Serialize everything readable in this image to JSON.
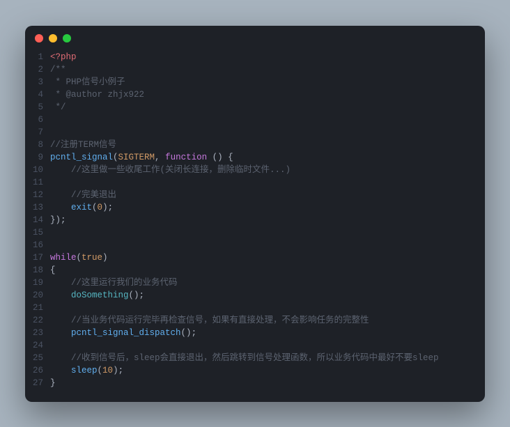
{
  "window": {
    "dots": [
      "red",
      "yellow",
      "green"
    ]
  },
  "code": {
    "lines": [
      {
        "n": "1",
        "seg": [
          {
            "c": "k-php",
            "t": "<?php"
          }
        ]
      },
      {
        "n": "2",
        "seg": [
          {
            "c": "k-comment",
            "t": "/**"
          }
        ]
      },
      {
        "n": "3",
        "seg": [
          {
            "c": "k-comment",
            "t": " * PHP信号小例子"
          }
        ]
      },
      {
        "n": "4",
        "seg": [
          {
            "c": "k-comment",
            "t": " * @author zhjx922"
          }
        ]
      },
      {
        "n": "5",
        "seg": [
          {
            "c": "k-comment",
            "t": " */"
          }
        ]
      },
      {
        "n": "6",
        "seg": []
      },
      {
        "n": "7",
        "seg": []
      },
      {
        "n": "8",
        "seg": [
          {
            "c": "k-comment",
            "t": "//注册TERM信号"
          }
        ]
      },
      {
        "n": "9",
        "seg": [
          {
            "c": "k-func",
            "t": "pcntl_signal"
          },
          {
            "c": "k-paren",
            "t": "("
          },
          {
            "c": "k-const",
            "t": "SIGTERM"
          },
          {
            "c": "k-punct",
            "t": ", "
          },
          {
            "c": "k-keyword",
            "t": "function"
          },
          {
            "c": "k-punct",
            "t": " "
          },
          {
            "c": "k-paren",
            "t": "()"
          },
          {
            "c": "k-punct",
            "t": " {"
          }
        ]
      },
      {
        "n": "10",
        "seg": [
          {
            "c": "k-punct",
            "t": "    "
          },
          {
            "c": "k-comment",
            "t": "//这里做一些收尾工作(关闭长连接，删除临时文件...)"
          }
        ]
      },
      {
        "n": "11",
        "seg": []
      },
      {
        "n": "12",
        "seg": [
          {
            "c": "k-punct",
            "t": "    "
          },
          {
            "c": "k-comment",
            "t": "//完美退出"
          }
        ]
      },
      {
        "n": "13",
        "seg": [
          {
            "c": "k-punct",
            "t": "    "
          },
          {
            "c": "k-func",
            "t": "exit"
          },
          {
            "c": "k-paren",
            "t": "("
          },
          {
            "c": "k-num",
            "t": "0"
          },
          {
            "c": "k-paren",
            "t": ")"
          },
          {
            "c": "k-punct",
            "t": ";"
          }
        ]
      },
      {
        "n": "14",
        "seg": [
          {
            "c": "k-punct",
            "t": "});"
          }
        ]
      },
      {
        "n": "15",
        "seg": []
      },
      {
        "n": "16",
        "seg": []
      },
      {
        "n": "17",
        "seg": [
          {
            "c": "k-keyword",
            "t": "while"
          },
          {
            "c": "k-paren",
            "t": "("
          },
          {
            "c": "k-bool",
            "t": "true"
          },
          {
            "c": "k-paren",
            "t": ")"
          }
        ]
      },
      {
        "n": "18",
        "seg": [
          {
            "c": "k-punct",
            "t": "{"
          }
        ]
      },
      {
        "n": "19",
        "seg": [
          {
            "c": "k-punct",
            "t": "    "
          },
          {
            "c": "k-comment",
            "t": "//这里运行我们的业务代码"
          }
        ]
      },
      {
        "n": "20",
        "seg": [
          {
            "c": "k-punct",
            "t": "    "
          },
          {
            "c": "k-call",
            "t": "doSomething"
          },
          {
            "c": "k-paren",
            "t": "()"
          },
          {
            "c": "k-punct",
            "t": ";"
          }
        ]
      },
      {
        "n": "21",
        "seg": []
      },
      {
        "n": "22",
        "seg": [
          {
            "c": "k-punct",
            "t": "    "
          },
          {
            "c": "k-comment",
            "t": "//当业务代码运行完毕再检查信号，如果有直接处理，不会影响任务的完整性"
          }
        ]
      },
      {
        "n": "23",
        "seg": [
          {
            "c": "k-punct",
            "t": "    "
          },
          {
            "c": "k-func",
            "t": "pcntl_signal_dispatch"
          },
          {
            "c": "k-paren",
            "t": "()"
          },
          {
            "c": "k-punct",
            "t": ";"
          }
        ]
      },
      {
        "n": "24",
        "seg": []
      },
      {
        "n": "25",
        "seg": [
          {
            "c": "k-punct",
            "t": "    "
          },
          {
            "c": "k-comment",
            "t": "//收到信号后，sleep会直接退出，然后跳转到信号处理函数，所以业务代码中最好不要sleep"
          }
        ]
      },
      {
        "n": "26",
        "seg": [
          {
            "c": "k-punct",
            "t": "    "
          },
          {
            "c": "k-func",
            "t": "sleep"
          },
          {
            "c": "k-paren",
            "t": "("
          },
          {
            "c": "k-num",
            "t": "10"
          },
          {
            "c": "k-paren",
            "t": ")"
          },
          {
            "c": "k-punct",
            "t": ";"
          }
        ]
      },
      {
        "n": "27",
        "seg": [
          {
            "c": "k-punct",
            "t": "}"
          }
        ]
      }
    ]
  }
}
